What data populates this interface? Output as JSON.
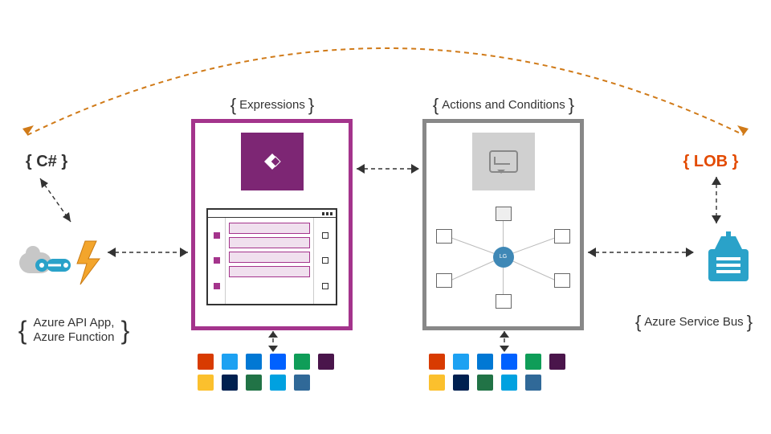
{
  "labels": {
    "expressions": "Expressions",
    "actions_conditions": "Actions and Conditions",
    "csharp": "{ C# }",
    "lob": "{ LOB }",
    "azure_api_fn_line1": "Azure API App,",
    "azure_api_fn_line2": "Azure Function",
    "service_bus": "Azure Service Bus"
  },
  "panels": {
    "left": {
      "accent": "#a4348c"
    },
    "right": {
      "accent": "#888888"
    }
  },
  "connector_rows": {
    "row1": [
      "office",
      "twitter",
      "onedrive",
      "dropbox",
      "gdrive",
      "slack"
    ],
    "row2": [
      "mailchimp",
      "dynamics",
      "sharepoint",
      "salesforce",
      "sql"
    ]
  },
  "colors": {
    "arc": "#d07a18",
    "logicapp": "#2aa2c9",
    "function": "#f3a52c",
    "servicebus": "#2aa2c9"
  }
}
